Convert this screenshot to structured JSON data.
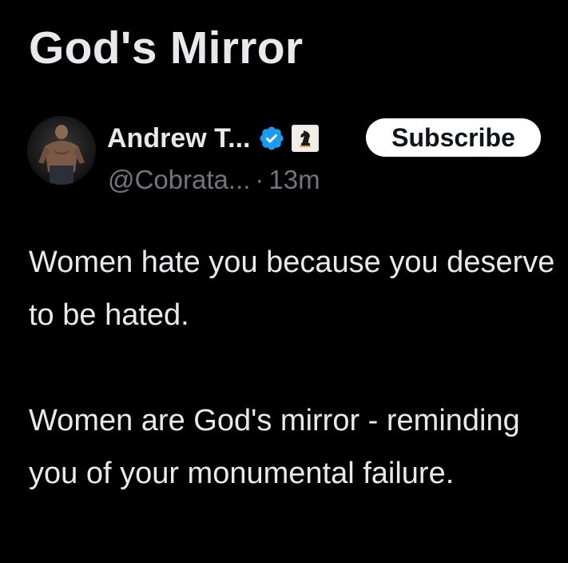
{
  "header": {
    "title": "God's Mirror"
  },
  "author": {
    "display_name": "Andrew T...",
    "handle": "@Cobrata...",
    "separator": "·",
    "timestamp": "13m",
    "verified_icon": "verified-badge-icon",
    "affiliate_icon": "chess-knight-icon"
  },
  "actions": {
    "subscribe_label": "Subscribe"
  },
  "post": {
    "paragraph_1": "Women hate you because you deserve to be hated.",
    "paragraph_2": "Women are God's mirror - reminding you of your monumental failure."
  },
  "colors": {
    "background": "#000000",
    "primary_text": "#e7e9ea",
    "secondary_text": "#71767b",
    "verified_blue": "#1d9bf0",
    "button_bg": "#ffffff",
    "button_text": "#0f1419"
  }
}
